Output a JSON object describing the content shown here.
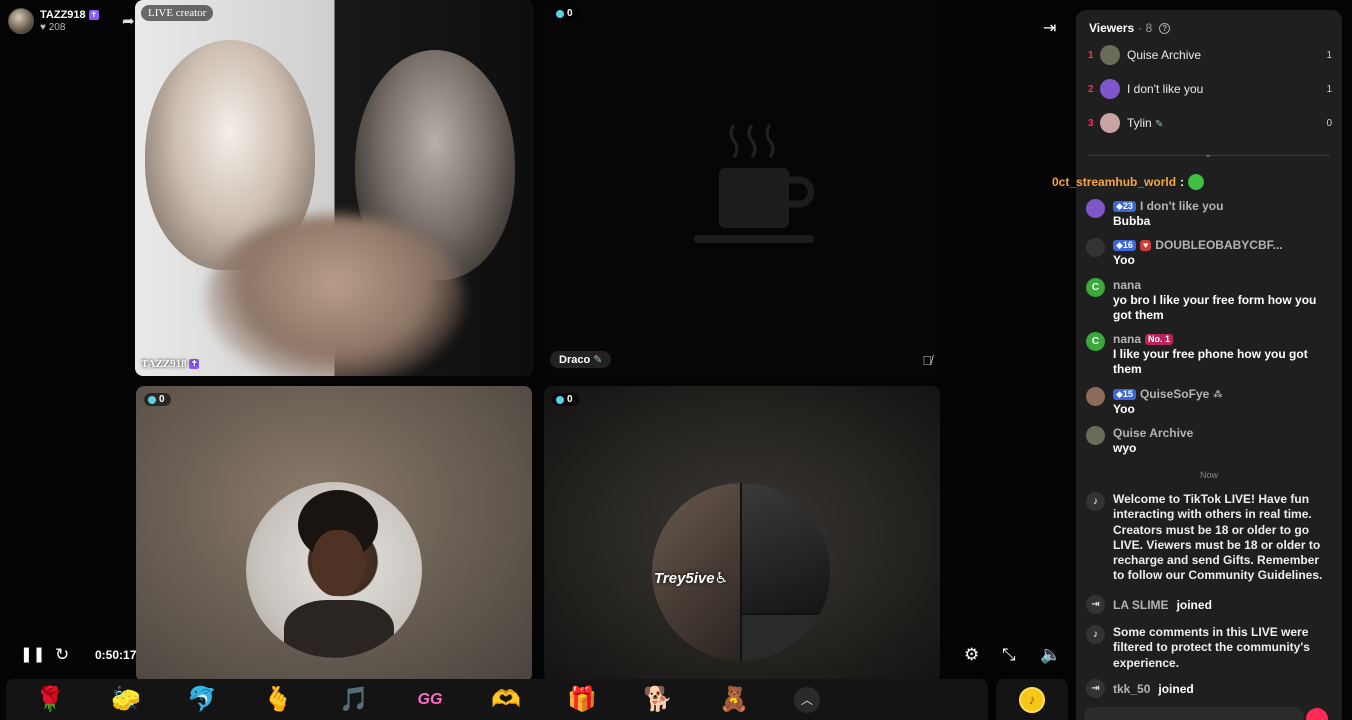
{
  "host": {
    "name": "TAZZ918",
    "likes": "208",
    "badge": "✝"
  },
  "tiles": {
    "t1": {
      "live_tag": "LIVE creator",
      "name": "TAZZ918",
      "badge": "✝"
    },
    "t2": {
      "viewers": "0",
      "name": "Draco"
    },
    "t3": {
      "viewers": "0"
    },
    "t4": {
      "viewers": "0",
      "overlay_text": "Trey5ive♿"
    }
  },
  "player": {
    "time": "0:50:17",
    "pause_icon": "pause-icon",
    "refresh_icon": "refresh-icon"
  },
  "gifts": [
    {
      "name": "rose",
      "glyph": "🌹"
    },
    {
      "name": "sponge",
      "glyph": "🧽"
    },
    {
      "name": "dolphin",
      "glyph": "🐬"
    },
    {
      "name": "finger-heart",
      "glyph": "🫰"
    },
    {
      "name": "tiktok",
      "glyph": "🎵"
    },
    {
      "name": "gg",
      "glyph": "GG"
    },
    {
      "name": "heart-hands",
      "glyph": "🫶"
    },
    {
      "name": "gift-box",
      "glyph": "🎁"
    },
    {
      "name": "corgi",
      "glyph": "🐕"
    },
    {
      "name": "bear",
      "glyph": "🧸"
    }
  ],
  "viewers_panel": {
    "title": "Viewers",
    "count": "· 8",
    "list": [
      {
        "rank": "1",
        "name": "Quise Archive",
        "score": "1",
        "color": "#6b6b5a"
      },
      {
        "rank": "2",
        "name": "I don't like you",
        "score": "1",
        "color": "#7e56c9"
      },
      {
        "rank": "3",
        "name": "Tylin",
        "score": "0",
        "color": "#c9a3a3"
      }
    ]
  },
  "floating_gift": {
    "user": "0ct_streamhub_world",
    "sep": ":"
  },
  "chat": [
    {
      "user": "I don't like you",
      "level": "23",
      "text": "Bubba",
      "avatar_color": "#7e56c9"
    },
    {
      "user": "DOUBLEOBABYCBF...",
      "level": "16",
      "text": "Yoo",
      "avatar_color": "#333333"
    },
    {
      "user": "nana",
      "text": "yo bro I like your free form how you got them",
      "avatar_letter": "C",
      "avatar_color": "#3aa83a"
    },
    {
      "user": "nana",
      "rank_badge": "No. 1",
      "text": "I like your free phone how you got them",
      "avatar_letter": "C",
      "avatar_color": "#3aa83a"
    },
    {
      "user": "QuiseSoFye",
      "level": "15",
      "text": "Yoo",
      "avatar_color": "#8b6b5a"
    },
    {
      "user": "Quise Archive",
      "text": "wyo",
      "avatar_color": "#6b6b5a"
    }
  ],
  "now_label": "Now",
  "system": {
    "welcome": "Welcome to TikTok LIVE! Have fun interacting with others in real time. Creators must be 18 or older to go LIVE. Viewers must be 18 or older to recharge and send Gifts. Remember to follow our Community Guidelines.",
    "join1_user": "LA SLIME",
    "join_text": "joined",
    "filtered": "Some comments in this LIVE were filtered to protect the community's experience.",
    "join2_user": "tkk_50"
  }
}
